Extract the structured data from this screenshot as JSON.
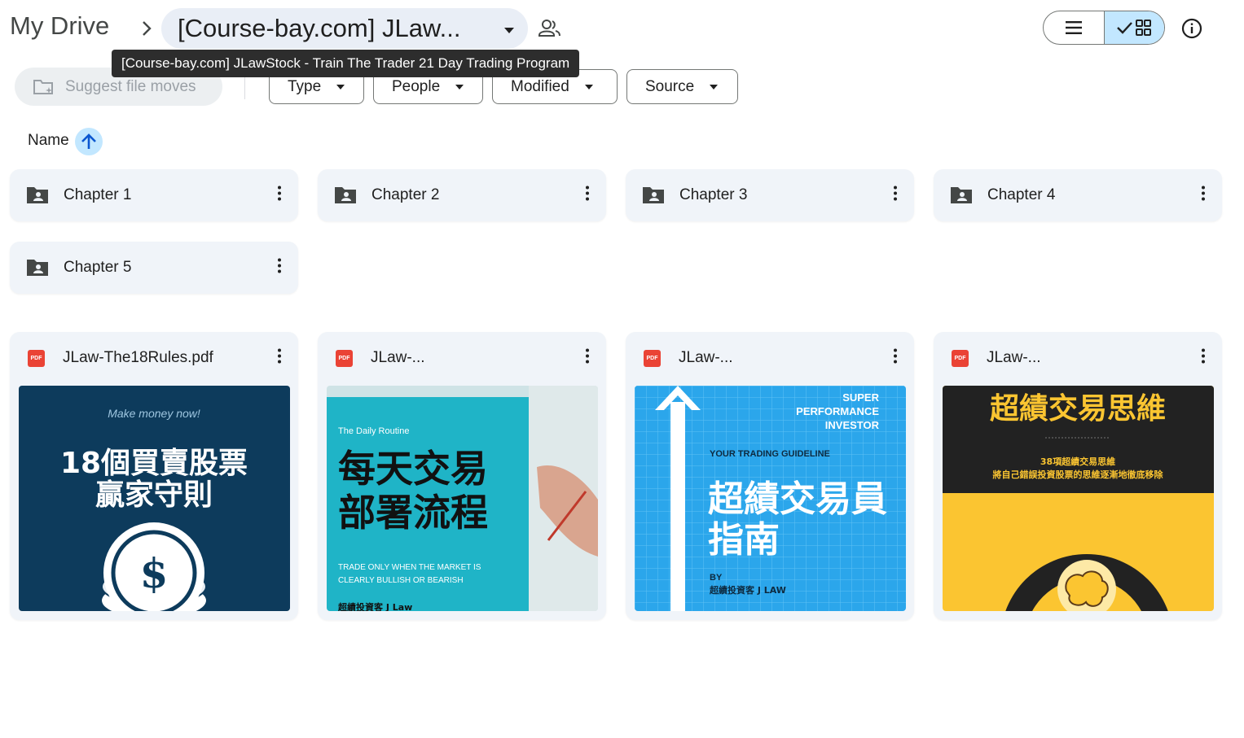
{
  "breadcrumb": {
    "root": "My Drive",
    "current": "[Course-bay.com] JLaw...",
    "tooltip": "[Course-bay.com] JLawStock - Train The Trader 21 Day Trading Program"
  },
  "toolbar": {
    "suggest_label": "Suggest file moves",
    "filters": [
      "Type",
      "People",
      "Modified",
      "Source"
    ]
  },
  "sort": {
    "label": "Name",
    "direction": "ascending"
  },
  "folders": [
    {
      "name": "Chapter 1"
    },
    {
      "name": "Chapter 2"
    },
    {
      "name": "Chapter 3"
    },
    {
      "name": "Chapter 4"
    },
    {
      "name": "Chapter 5"
    }
  ],
  "files": [
    {
      "name": "JLaw-The18Rules.pdf",
      "thumb": {
        "tagline": "Make money now!",
        "line1": "18個買賣股票",
        "line2": "贏家守則",
        "symbol": "$"
      }
    },
    {
      "name": "JLaw-...",
      "thumb": {
        "eyebrow": "The Daily Routine",
        "line1": "每天交易",
        "line2": "部署流程",
        "foot1": "TRADE ONLY WHEN THE MARKET IS",
        "foot2": "CLEARLY BULLISH OR BEARISH",
        "author": "超績投資客 J Law"
      }
    },
    {
      "name": "JLaw-...",
      "thumb": {
        "top1": "SUPER",
        "top2": "PERFORMANCE",
        "top3": "INVESTOR",
        "sub": "YOUR TRADING GUIDELINE",
        "line1": "超績交易員",
        "line2": "指南",
        "by": "BY",
        "author": "超績投資客 J LAW"
      }
    },
    {
      "name": "JLaw-...",
      "thumb": {
        "title": "超績交易思維",
        "sub1": "38項超績交易思維",
        "sub2": "將自己錯誤投資股票的思維逐漸地徹底移除"
      }
    }
  ],
  "colors": {
    "accent": "#c2e7ff",
    "card_bg": "#f0f4f9",
    "pdf_red": "#ea4335"
  }
}
